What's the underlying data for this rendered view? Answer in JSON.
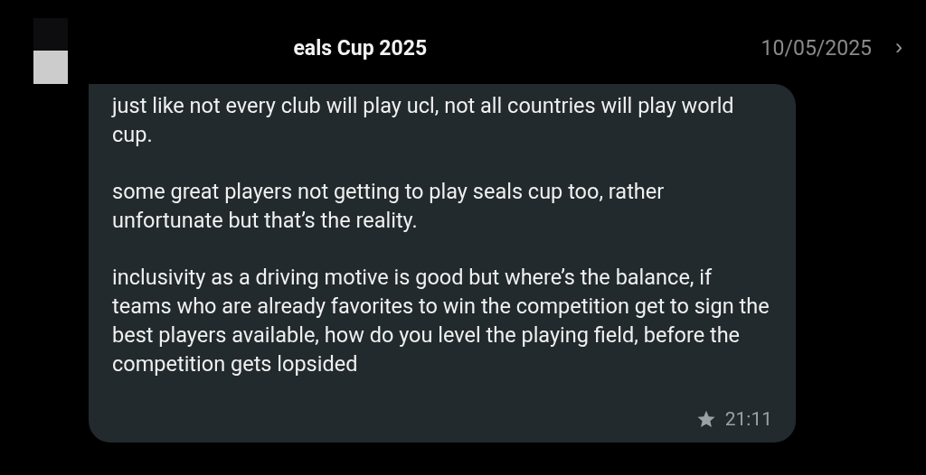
{
  "header": {
    "title": "eals Cup 2025",
    "date": "10/05/2025",
    "chevron": "›"
  },
  "message": {
    "paragraphs": [
      "just like not every club will play ucl, not all countries will play world cup.",
      "some great players not getting to play seals cup too, rather unfortunate but that’s the reality.",
      "inclusivity as a driving motive is good but where’s the balance, if teams who are already favorites to win the competition get to sign the best players available, how do you level the playing field, before the competition gets lopsided"
    ],
    "starred": true,
    "time": "21:11"
  }
}
